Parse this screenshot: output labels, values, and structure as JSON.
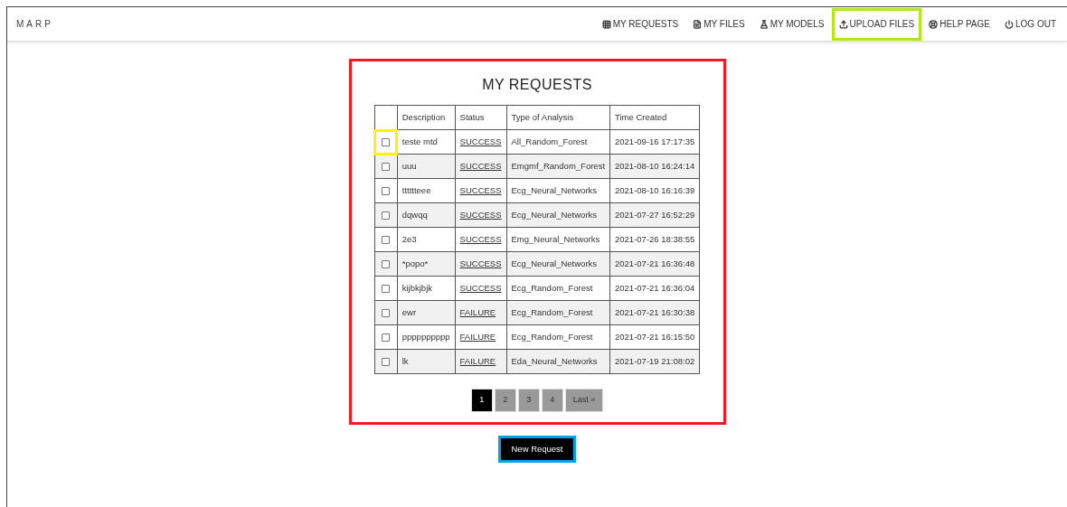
{
  "brand": "MARP",
  "nav": [
    {
      "kind": "grid",
      "label": "MY REQUESTS"
    },
    {
      "kind": "file",
      "label": "MY FILES"
    },
    {
      "kind": "flask",
      "label": "MY MODELS"
    },
    {
      "kind": "upload",
      "label": "UPLOAD FILES",
      "color": "#b5e61d"
    },
    {
      "kind": "lifebuoy",
      "label": "HELP PAGE"
    },
    {
      "kind": "power",
      "label": "LOG OUT"
    }
  ],
  "panel": {
    "title": "MY REQUESTS",
    "color": "#ed1c24",
    "table": {
      "columns": [
        "Description",
        "Status",
        "Type of Analysis",
        "Time Created"
      ],
      "rows": [
        {
          "checked": false,
          "color": "#fff200",
          "description": "teste mtd",
          "status": "SUCCESS",
          "analysis": "All_Random_Forest",
          "time": "2021-09-16 17:17:35"
        },
        {
          "checked": false,
          "description": "uuu",
          "status": "SUCCESS",
          "analysis": "Emgmf_Random_Forest",
          "time": "2021-08-10 16:24:14"
        },
        {
          "checked": false,
          "description": "tttttteee",
          "status": "SUCCESS",
          "analysis": "Ecg_Neural_Networks",
          "time": "2021-08-10 16:16:39"
        },
        {
          "checked": false,
          "description": "dqwqq",
          "status": "SUCCESS",
          "analysis": "Ecg_Neural_Networks",
          "time": "2021-07-27 16:52:29"
        },
        {
          "checked": false,
          "description": "2e3",
          "status": "SUCCESS",
          "analysis": "Emg_Neural_Networks",
          "time": "2021-07-26 18:38:55"
        },
        {
          "checked": false,
          "description": "*popo*",
          "status": "SUCCESS",
          "analysis": "Ecg_Neural_Networks",
          "time": "2021-07-21 16:36:48"
        },
        {
          "checked": false,
          "description": "kijbkjbjk",
          "status": "SUCCESS",
          "analysis": "Ecg_Random_Forest",
          "time": "2021-07-21 16:36:04"
        },
        {
          "checked": false,
          "description": "ewr",
          "status": "FAILURE",
          "analysis": "Ecg_Random_Forest",
          "time": "2021-07-21 16:30:38"
        },
        {
          "checked": false,
          "description": "pppppppppp",
          "status": "FAILURE",
          "analysis": "Ecg_Random_Forest",
          "time": "2021-07-21 16:15:50"
        },
        {
          "checked": false,
          "description": "lk",
          "status": "FAILURE",
          "analysis": "Eda_Neural_Networks",
          "time": "2021-07-19 21:08:02"
        }
      ]
    },
    "pages": [
      {
        "label": "1",
        "selected": true
      },
      {
        "label": "2",
        "selected": false
      },
      {
        "label": "3",
        "selected": false
      },
      {
        "label": "4",
        "selected": false
      },
      {
        "label": "Last »",
        "selected": false
      }
    ]
  },
  "new_request": {
    "label": "New Request",
    "color": "#00a2e8"
  }
}
